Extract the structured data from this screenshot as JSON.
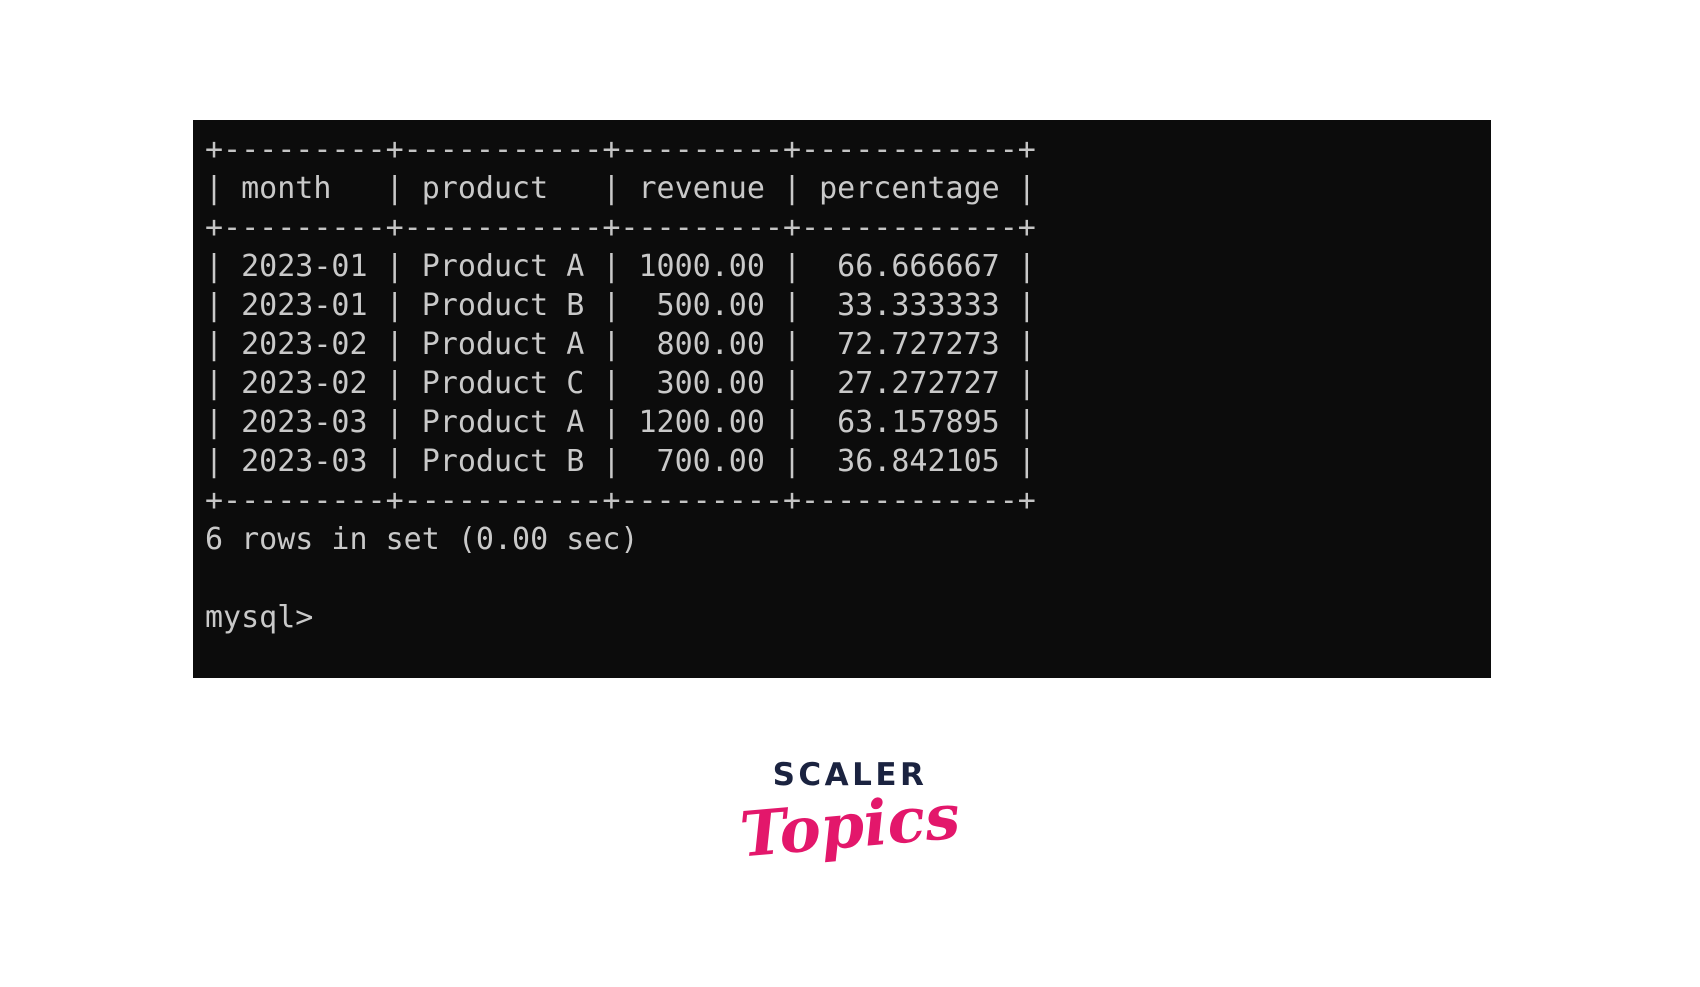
{
  "terminal": {
    "background_color": "#0c0c0c",
    "text_color": "#c9c9c9",
    "prompt": "mysql>",
    "status_line": "6 rows in set (0.00 sec)",
    "border_rule": "+---------+-----------+---------+------------+",
    "header_line": "| month   | product   | revenue | percentage |",
    "rows_text": [
      "| 2023-01 | Product A | 1000.00 |  66.666667 |",
      "| 2023-01 | Product B |  500.00 |  33.333333 |",
      "| 2023-02 | Product A |  800.00 |  72.727273 |",
      "| 2023-02 | Product C |  300.00 |  27.272727 |",
      "| 2023-03 | Product A | 1200.00 |  63.157895 |",
      "| 2023-03 | Product B |  700.00 |  36.842105 |"
    ]
  },
  "result_table": {
    "columns": [
      "month",
      "product",
      "revenue",
      "percentage"
    ],
    "rows": [
      [
        "2023-01",
        "Product A",
        "1000.00",
        "66.666667"
      ],
      [
        "2023-01",
        "Product B",
        "500.00",
        "33.333333"
      ],
      [
        "2023-02",
        "Product A",
        "800.00",
        "72.727273"
      ],
      [
        "2023-02",
        "Product C",
        "300.00",
        "27.272727"
      ],
      [
        "2023-03",
        "Product A",
        "1200.00",
        "63.157895"
      ],
      [
        "2023-03",
        "Product B",
        "700.00",
        "36.842105"
      ]
    ],
    "row_count": 6,
    "elapsed_seconds": "0.00"
  },
  "logo": {
    "top_text": "SCALER",
    "bottom_text": "Topics",
    "top_color": "#1b2340",
    "bottom_color": "#e3176b"
  }
}
